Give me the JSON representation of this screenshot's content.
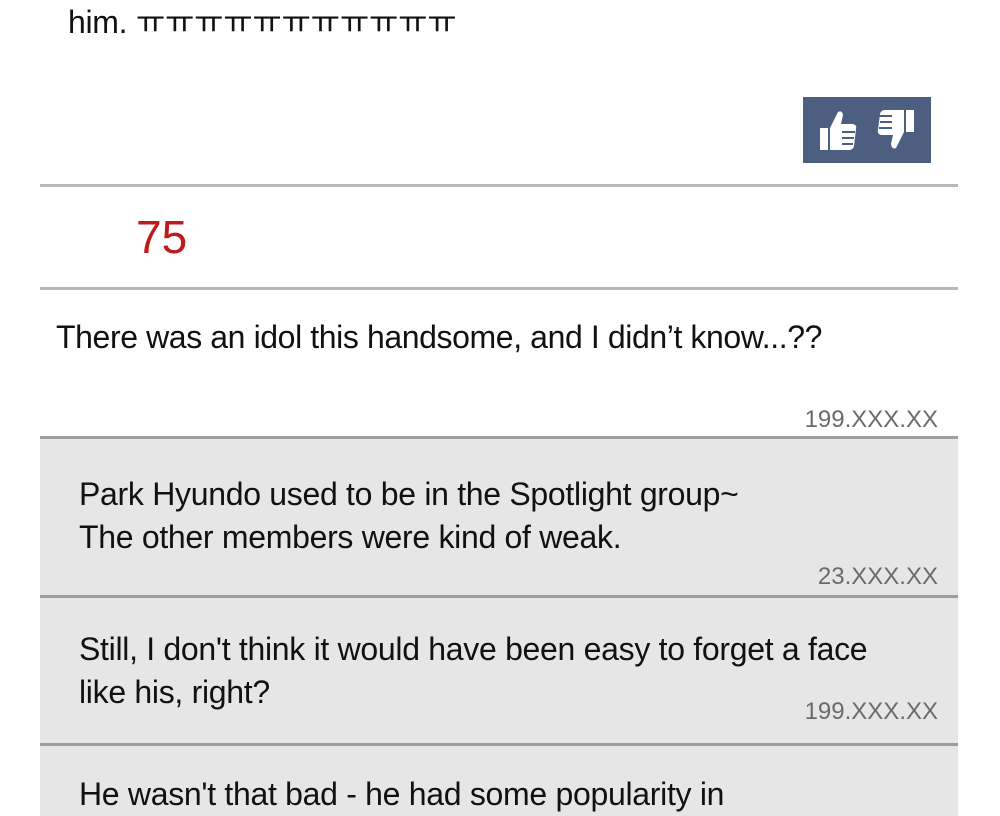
{
  "previous_comment": {
    "tail_text": "him. ㅠㅠㅠㅠㅠㅠㅠㅠㅠㅠㅠ"
  },
  "vote": {
    "up_icon": "thumbs-up-icon",
    "down_icon": "thumbs-down-icon",
    "color": "#4d5f80"
  },
  "comment": {
    "number": "75",
    "number_color": "#c01b1b",
    "text": "There was an idol this handsome, and I didn’t know...??",
    "ip": "199.XXX.XX"
  },
  "replies": [
    {
      "text": "Park Hyundo used to be in the Spotlight group~\nThe other members were kind of weak.",
      "ip": "23.XXX.XX"
    },
    {
      "text": "Still, I don't think it would have been easy to forget a face\nlike his, right?",
      "ip": "199.XXX.XX"
    },
    {
      "text": "He wasn't that bad - he had some popularity in",
      "ip": ""
    }
  ]
}
